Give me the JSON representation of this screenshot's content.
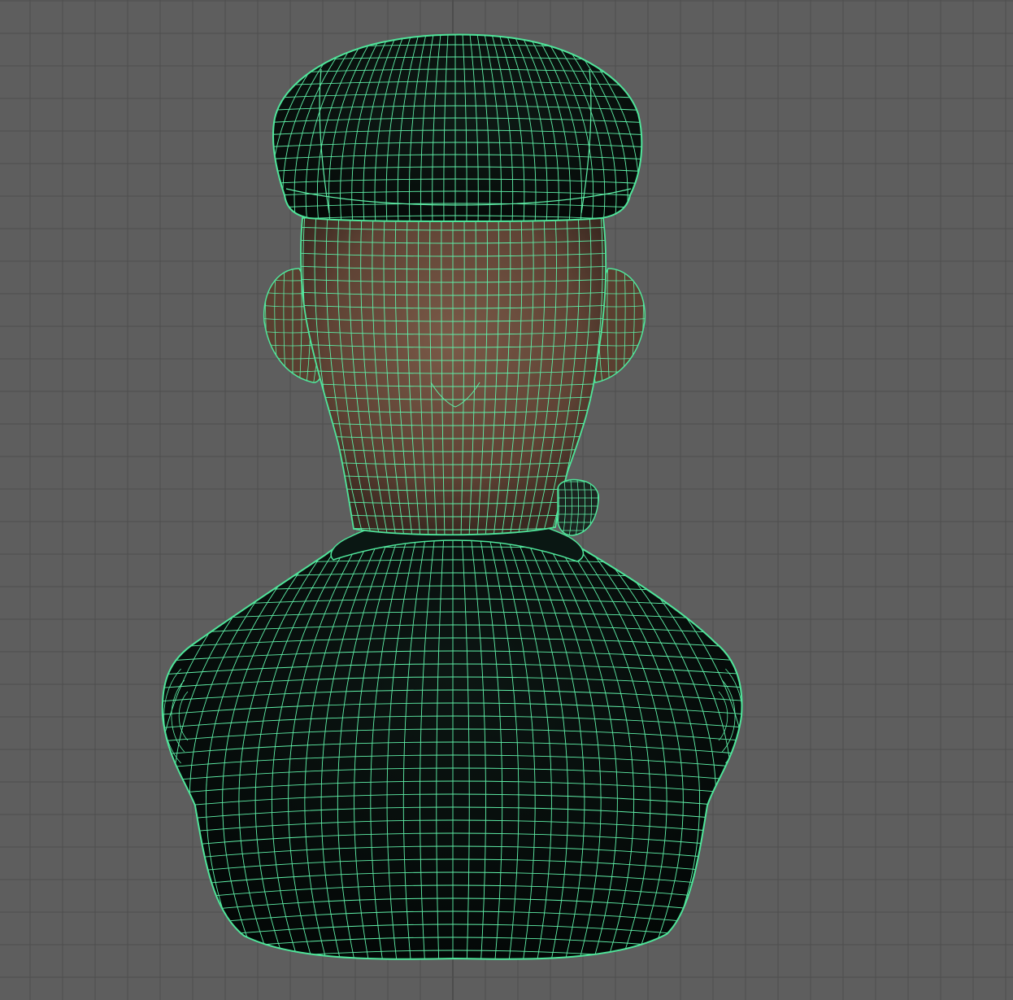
{
  "viewport": {
    "view": "orthographic-back",
    "display_mode": "wireframe-on-shaded",
    "background_color": "#5e5e5e",
    "grid_line_color": "#4e4e4e",
    "grid_axis_color": "#3a3a3a",
    "wireframe_color": "#5ff0a8",
    "selection_outline_color": "#4fe59a"
  },
  "model": {
    "parts": [
      {
        "name": "cap",
        "shade_color": "#0a1410"
      },
      {
        "name": "head",
        "shade_color": "#6a4c3c"
      },
      {
        "name": "ear-left",
        "shade_color": "#5a3f30"
      },
      {
        "name": "ear-right",
        "shade_color": "#5a3f30"
      },
      {
        "name": "pipe",
        "shade_color": "#1a2520"
      },
      {
        "name": "torso",
        "shade_color": "#070d0b"
      }
    ]
  }
}
